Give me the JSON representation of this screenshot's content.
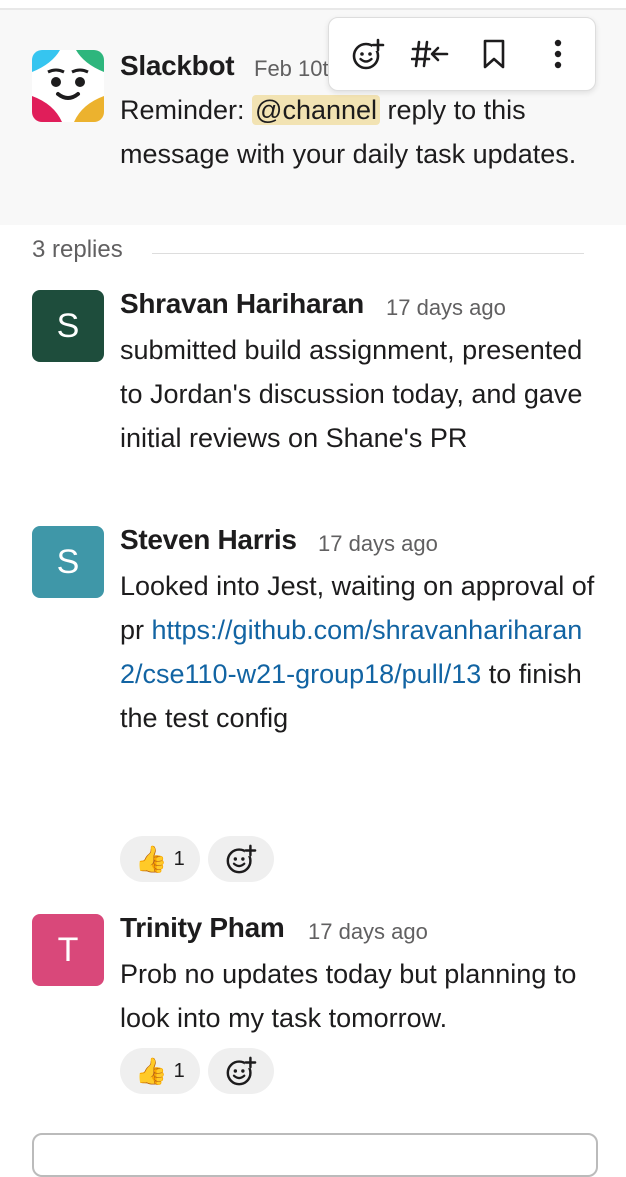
{
  "parent": {
    "author": "Slackbot",
    "time": "Feb 10th",
    "text_before": "Reminder: ",
    "mention": "@channel",
    "text_after": " reply to this message with your daily task updates."
  },
  "toolbar": {
    "icons": [
      "add-reaction-icon",
      "reply-in-channel-icon",
      "bookmark-icon",
      "more-icon"
    ]
  },
  "replies_label": "3 replies",
  "replies": [
    {
      "initial": "S",
      "avatar_color": "#1e4d3c",
      "author": "Shravan Hariharan",
      "time": "17 days ago",
      "text": "submitted build assignment, presented to Jordan's discussion today, and gave initial reviews on Shane's PR"
    },
    {
      "initial": "S",
      "avatar_color": "#3f97a8",
      "author": "Steven Harris",
      "time": "17 days ago",
      "text_before": "Looked into Jest, waiting on approval of pr ",
      "link": "https://github.com/shravanhariharan2/cse110-w21-group18/pull/13",
      "text_after": " to finish the test config",
      "reaction": {
        "emoji": "👍",
        "count": "1"
      }
    },
    {
      "initial": "T",
      "avatar_color": "#d9487a",
      "author": "Trinity Pham",
      "time": "17 days ago",
      "text": "Prob no updates today but planning to look into my task tomorrow.",
      "reaction": {
        "emoji": "👍",
        "count": "1"
      }
    }
  ]
}
